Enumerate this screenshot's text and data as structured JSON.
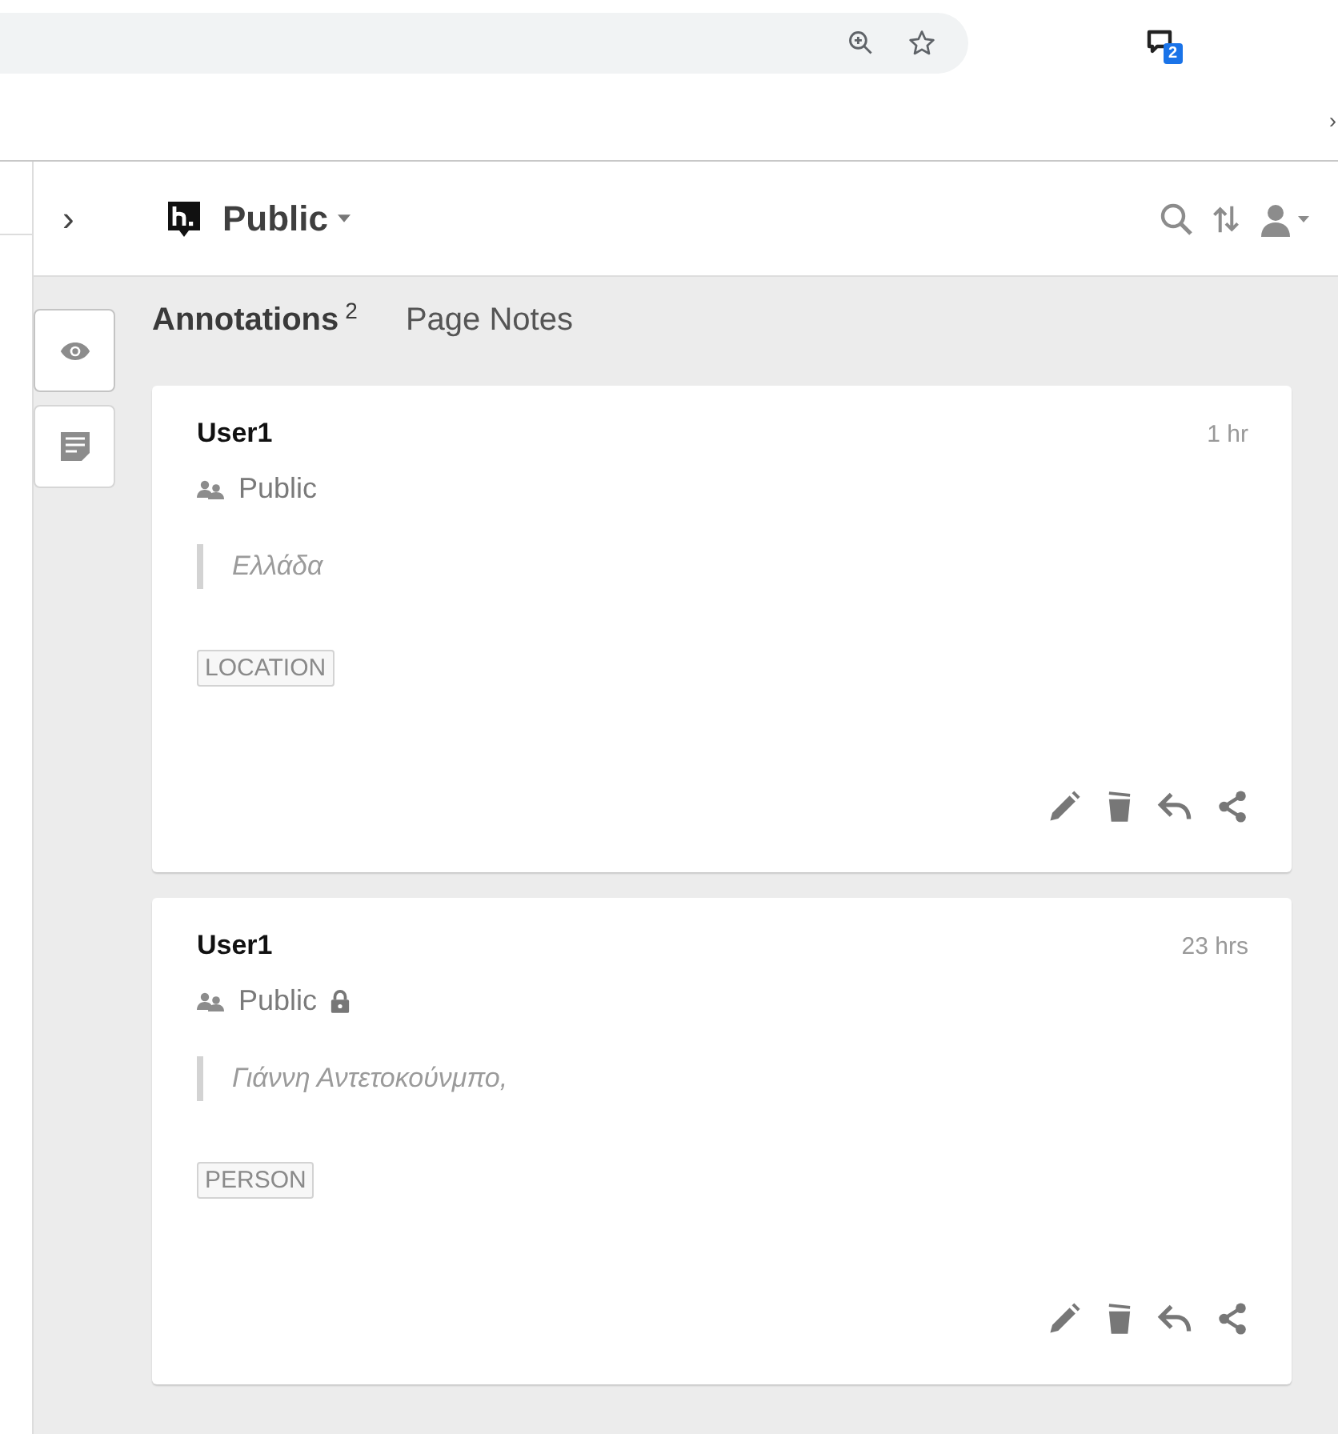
{
  "browser": {
    "extension_badge": "2",
    "overflow_mark": "›"
  },
  "sidebar_header": {
    "collapse": "›",
    "group": "Public"
  },
  "side_buttons": [
    {
      "kind": "eye",
      "selected": true
    },
    {
      "kind": "notes",
      "selected": false
    }
  ],
  "tabs": [
    {
      "label": "Annotations",
      "count": "2",
      "selected": true
    },
    {
      "label": "Page Notes",
      "selected": false
    }
  ],
  "annotations": [
    {
      "user": "User1",
      "time": "1 hr",
      "group": "Public",
      "locked": false,
      "quote": "Ελλάδα",
      "tags": [
        "LOCATION"
      ]
    },
    {
      "user": "User1",
      "time": "23 hrs",
      "group": "Public",
      "locked": true,
      "quote": "Γιάννη Αντετοκούνμπο,",
      "tags": [
        "PERSON"
      ]
    }
  ]
}
